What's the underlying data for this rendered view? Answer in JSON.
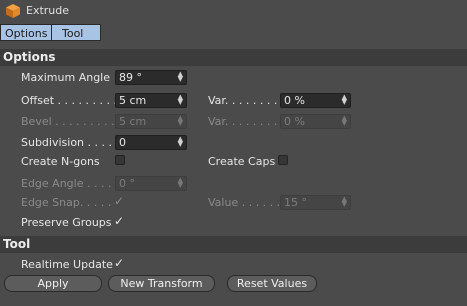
{
  "window": {
    "title": "Extrude",
    "icon": "cube-icon"
  },
  "tabs": [
    {
      "label": "Options"
    },
    {
      "label": "Tool"
    }
  ],
  "options": {
    "header": "Options",
    "max_angle": {
      "label": "Maximum Angle",
      "value": "89 °"
    },
    "offset": {
      "label": "Offset . . . . . . . . .",
      "value": "5 cm"
    },
    "offset_var": {
      "label": "Var. . . . . . . .",
      "value": "0 %"
    },
    "bevel": {
      "label": "Bevel . . . . . . . . .",
      "value": "5 cm"
    },
    "bevel_var": {
      "label": "Var. . . . . . . .",
      "value": "0 %"
    },
    "subdivision": {
      "label": "Subdivision . . . .",
      "value": "0"
    },
    "create_ngons": {
      "label": "Create N-gons",
      "checked": false
    },
    "create_caps": {
      "label": "Create Caps",
      "checked": false
    },
    "edge_angle": {
      "label": "Edge Angle . . . .",
      "value": "0 °"
    },
    "edge_snap": {
      "label": "Edge Snap. . . . .",
      "checked": true,
      "tick": "✓"
    },
    "value": {
      "label": "Value . . . . . .",
      "value": "15 °"
    },
    "preserve_groups": {
      "label": "Preserve Groups",
      "checked": true,
      "tick": "✓"
    }
  },
  "tool": {
    "header": "Tool",
    "realtime_update": {
      "label": "Realtime Update",
      "checked": true,
      "tick": "✓"
    },
    "buttons": {
      "apply": "Apply",
      "new_transform": "New Transform",
      "reset_values": "Reset Values"
    }
  },
  "spinner_glyph": "▲▼",
  "colors": {
    "background": "#4b4b4b",
    "section": "#3c3c3c",
    "tab_active": "#a9c3e4",
    "field": "#2b2b2b"
  }
}
